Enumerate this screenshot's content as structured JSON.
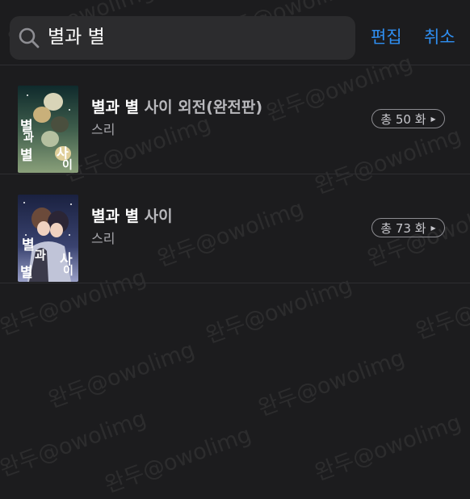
{
  "search": {
    "query": "별과 별",
    "edit_label": "편집",
    "cancel_label": "취소"
  },
  "results": [
    {
      "title_match": "별과 별",
      "title_rest": " 사이 외전(완전판)",
      "author": "스리",
      "episode_count": "총 50 화",
      "cover_text": [
        "별",
        "과",
        "별",
        "사",
        "이"
      ]
    },
    {
      "title_match": "별과 별",
      "title_rest": " 사이",
      "author": "스리",
      "episode_count": "총 73 화",
      "cover_text": [
        "별",
        "과",
        "별",
        "사",
        "이"
      ]
    }
  ],
  "watermark": "완두@owolimg",
  "colors": {
    "background": "#1c1c1e",
    "search_bg": "#2c2c2e",
    "accent": "#2f8ff2",
    "divider": "#2e2e31"
  }
}
